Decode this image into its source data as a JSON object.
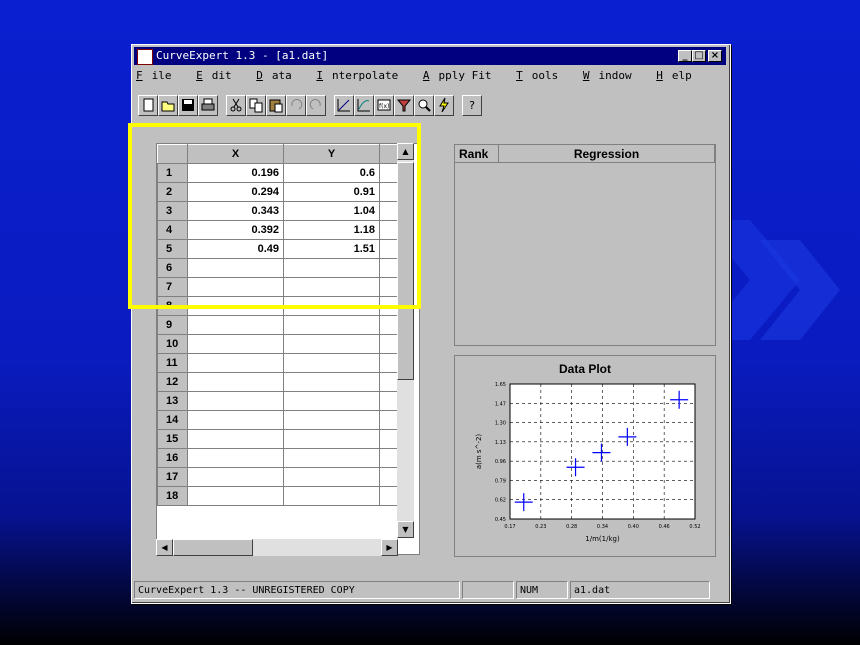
{
  "window": {
    "title": "CurveExpert 1.3 - [a1.dat]",
    "min": "_",
    "max": "□",
    "close": "×"
  },
  "menu": [
    {
      "accel": "F",
      "rest": "ile"
    },
    {
      "accel": "E",
      "rest": "dit"
    },
    {
      "accel": "D",
      "rest": "ata"
    },
    {
      "accel": "I",
      "rest": "nterpolate"
    },
    {
      "accel": "A",
      "rest": "pply Fit"
    },
    {
      "accel": "T",
      "rest": "ools"
    },
    {
      "accel": "W",
      "rest": "indow"
    },
    {
      "accel": "H",
      "rest": "elp"
    }
  ],
  "toolbar": {
    "icons": [
      "new-file-icon",
      "open-folder-icon",
      "save-icon",
      "print-icon",
      "cut-icon",
      "copy-icon",
      "paste-icon",
      "undo-icon",
      "redo-icon",
      "line-plot-icon",
      "fit-curve-icon",
      "function-icon",
      "filter-icon",
      "zoom-icon",
      "lightning-icon",
      "help-icon"
    ],
    "help_label": "?"
  },
  "sheet": {
    "columns": [
      "X",
      "Y"
    ],
    "rows": [
      {
        "n": "1",
        "x": "0.196",
        "y": "0.6"
      },
      {
        "n": "2",
        "x": "0.294",
        "y": "0.91"
      },
      {
        "n": "3",
        "x": "0.343",
        "y": "1.04"
      },
      {
        "n": "4",
        "x": "0.392",
        "y": "1.18"
      },
      {
        "n": "5",
        "x": "0.49",
        "y": "1.51"
      },
      {
        "n": "6",
        "x": "",
        "y": ""
      },
      {
        "n": "7",
        "x": "",
        "y": ""
      },
      {
        "n": "8",
        "x": "",
        "y": ""
      },
      {
        "n": "9",
        "x": "",
        "y": ""
      },
      {
        "n": "10",
        "x": "",
        "y": ""
      },
      {
        "n": "11",
        "x": "",
        "y": ""
      },
      {
        "n": "12",
        "x": "",
        "y": ""
      },
      {
        "n": "13",
        "x": "",
        "y": ""
      },
      {
        "n": "14",
        "x": "",
        "y": ""
      },
      {
        "n": "15",
        "x": "",
        "y": ""
      },
      {
        "n": "16",
        "x": "",
        "y": ""
      },
      {
        "n": "17",
        "x": "",
        "y": ""
      },
      {
        "n": "18",
        "x": "",
        "y": ""
      }
    ]
  },
  "rank": {
    "col1": "Rank",
    "col2": "Regression"
  },
  "plot": {
    "title": "Data Plot",
    "xlabel": "1/m(1/kg)",
    "ylabel": "a(m s^-2)",
    "xticks": [
      "0.17",
      "0.23",
      "0.28",
      "0.34",
      "0.40",
      "0.46",
      "0.52"
    ],
    "yticks": [
      "0.45",
      "0.62",
      "0.79",
      "0.96",
      "1.13",
      "1.30",
      "1.47",
      "1.65"
    ]
  },
  "chart_data": {
    "type": "scatter",
    "title": "Data Plot",
    "xlabel": "1/m(1/kg)",
    "ylabel": "a(m s^-2)",
    "x": [
      0.196,
      0.294,
      0.343,
      0.392,
      0.49
    ],
    "y": [
      0.6,
      0.91,
      1.04,
      1.18,
      1.51
    ],
    "xlim": [
      0.17,
      0.52
    ],
    "ylim": [
      0.45,
      1.65
    ],
    "grid": true
  },
  "status": {
    "main": "CurveExpert 1.3 -- UNREGISTERED COPY",
    "num": "NUM",
    "file": "a1.dat"
  },
  "colors": {
    "marker": "#0000ff",
    "highlight": "#ffff00",
    "titlebar": "#000080"
  }
}
